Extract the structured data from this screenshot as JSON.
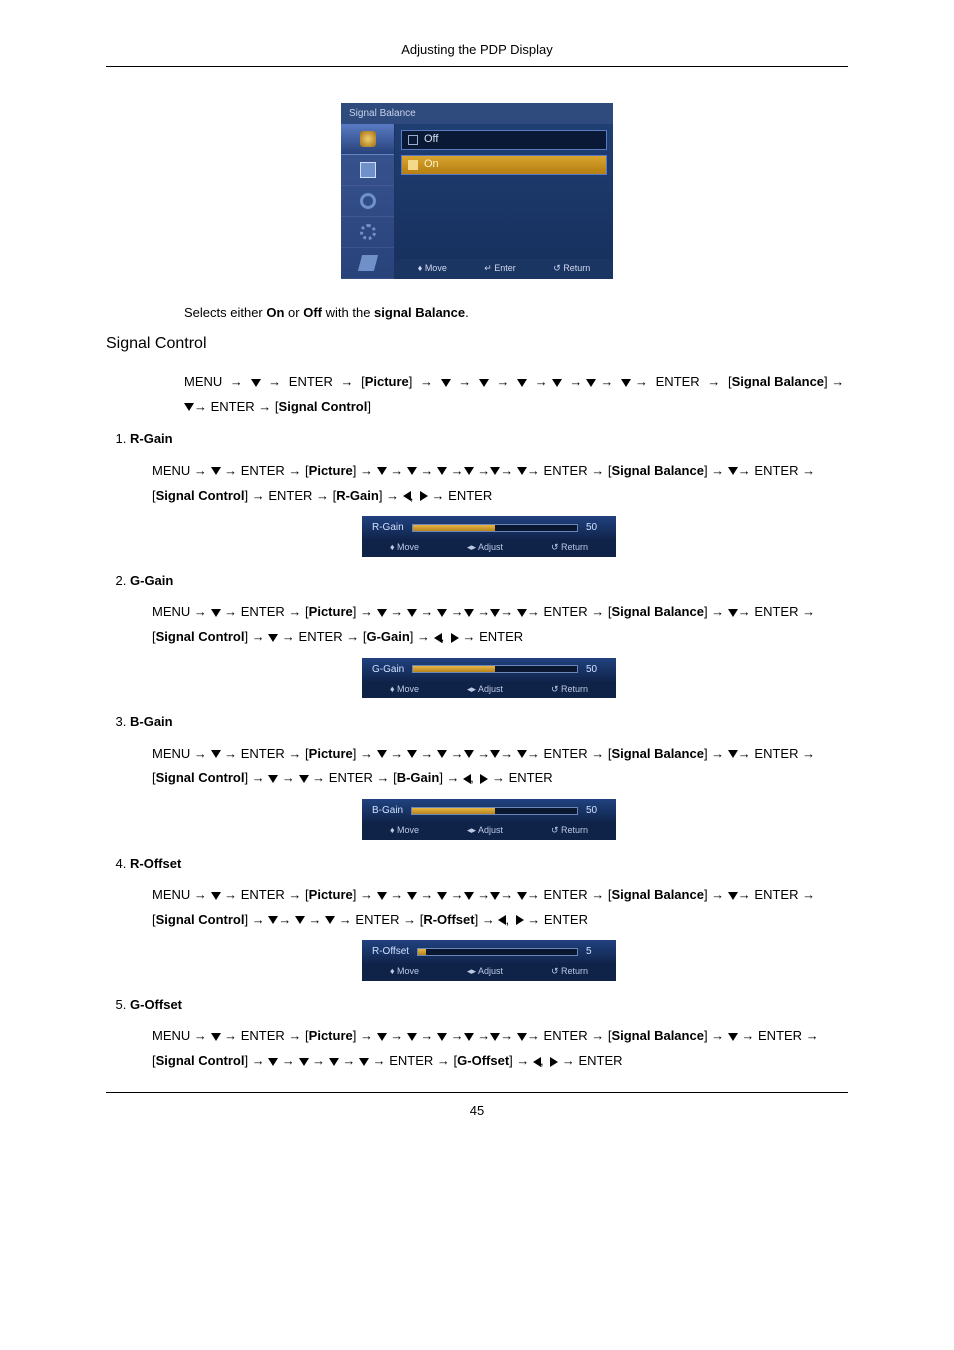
{
  "header": "Adjusting the PDP Display",
  "osd": {
    "title": "Signal Balance",
    "options": {
      "off": "Off",
      "on": "On"
    },
    "footer": {
      "move": "Move",
      "movePrefix": "♦",
      "enter": "Enter",
      "enterPrefix": "↵",
      "ret": "Return",
      "retPrefix": "↺"
    }
  },
  "intro": {
    "prefix": "Selects either ",
    "on": "On",
    "mid": " or ",
    "off": "Off",
    "mid2": " with the ",
    "sb": "signal Balance",
    "suffix": "."
  },
  "sectionTitle": "Signal Control",
  "nav": {
    "menu": "MENU",
    "enter": "ENTER",
    "picture": "Picture",
    "signalBalance": "Signal Balance",
    "signalControl": "Signal Control",
    "rgain": "R-Gain",
    "ggain": "G-Gain",
    "bgain": "B-Gain",
    "roffset": "R-Offset",
    "goffset": "G-Offset"
  },
  "steps": {
    "s1": {
      "title": "R-Gain"
    },
    "s2": {
      "title": "G-Gain"
    },
    "s3": {
      "title": "B-Gain"
    },
    "s4": {
      "title": "R-Offset"
    },
    "s5": {
      "title": "G-Offset"
    }
  },
  "adj": {
    "rgain": {
      "label": "R-Gain",
      "value": "50",
      "fillPct": 50
    },
    "ggain": {
      "label": "G-Gain",
      "value": "50",
      "fillPct": 50
    },
    "bgain": {
      "label": "B-Gain",
      "value": "50",
      "fillPct": 50
    },
    "roffset": {
      "label": "R-Offset",
      "value": "5",
      "fillPct": 5
    },
    "footer": {
      "move": "Move",
      "adjust": "Adjust",
      "ret": "Return"
    }
  },
  "pageNumber": "45"
}
